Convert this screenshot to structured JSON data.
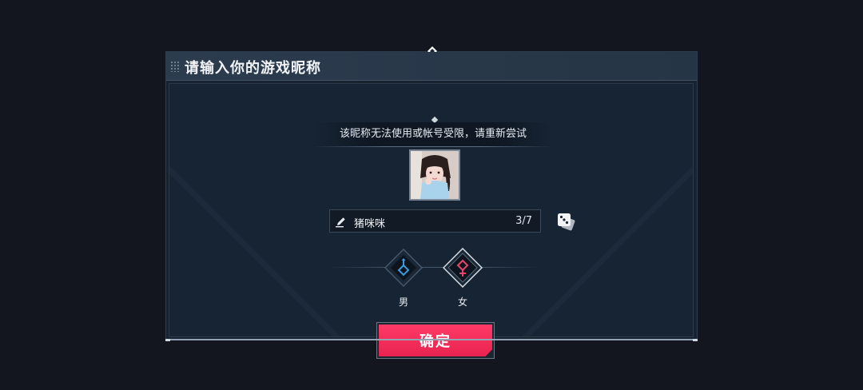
{
  "dialog": {
    "title": "请输入你的游戏昵称",
    "warning": "该昵称无法使用或帐号受限，请重新尝试"
  },
  "nickname": {
    "value": "猪咪咪",
    "count": "3/7"
  },
  "gender": {
    "male_label": "男",
    "female_label": "女",
    "selected": "female"
  },
  "confirm_label": "确定",
  "colors": {
    "accent": "#ff3a66",
    "male": "#3a9be0",
    "female": "#e8456c",
    "panel": "#172331"
  },
  "icons": {
    "edit": "pencil-icon",
    "randomize": "dice-icon",
    "male": "male-symbol-icon",
    "female": "female-symbol-icon"
  }
}
